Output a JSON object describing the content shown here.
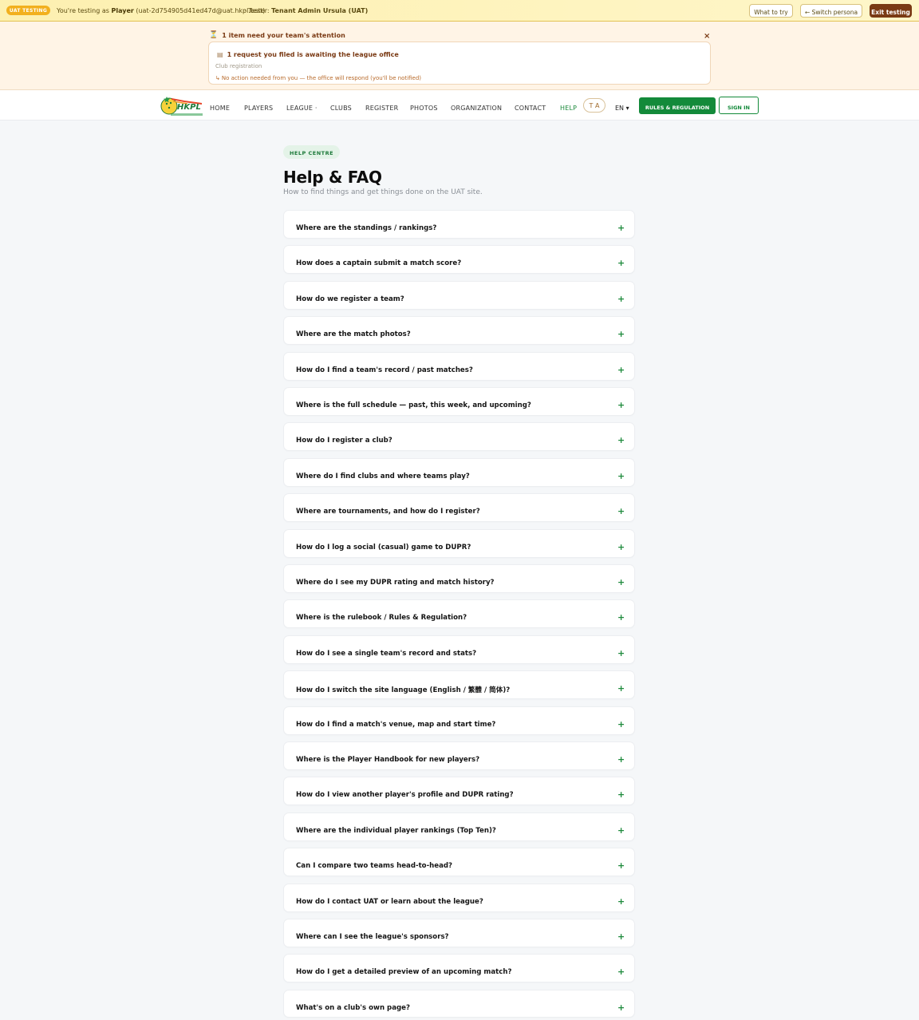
{
  "uat_bar": {
    "badge": "UAT TESTING",
    "testing_prefix": "You're testing as",
    "persona": "Player",
    "persona_email": "(uat-2d754905d41ed47d@uat.hkpl.test)",
    "tester_prefix": "· Tester:",
    "tester_name": "Tenant Admin Ursula (UAT)",
    "what_to_try": "What to try",
    "switch_persona": "← Switch persona",
    "exit_testing": "Exit testing"
  },
  "attention": {
    "icon": "hourglass-icon",
    "title": "1 item need your team's attention",
    "close": "×",
    "card": {
      "icon": "document-icon",
      "headline": "1 request you filed is awaiting the league office",
      "category": "Club registration",
      "note_prefix": "↳",
      "note": "No action needed from you — the office will respond (you'll be notified)"
    }
  },
  "nav": {
    "logo": "HKPL",
    "links": [
      {
        "label": "HOME"
      },
      {
        "label": "PLAYERS"
      },
      {
        "label": "LEAGUE ·"
      },
      {
        "label": "CLUBS"
      },
      {
        "label": "REGISTER"
      },
      {
        "label": "PHOTOS"
      },
      {
        "label": "ORGANIZATION"
      },
      {
        "label": "CONTACT"
      },
      {
        "label": "HELP"
      }
    ],
    "translate_icon": "translate-icon",
    "translate_label": "T A",
    "language": "EN ▾",
    "rules_button": "RULES & REGULATION",
    "signin_button": "SIGN IN",
    "accent": "#138a3a"
  },
  "page": {
    "pill": "HELP CENTRE",
    "title": "Help & FAQ",
    "subtitle": "How to find things and get things done on the UAT site."
  },
  "faq": [
    "Where are the standings / rankings?",
    "How does a captain submit a match score?",
    "How do we register a team?",
    "Where are the match photos?",
    "How do I find a team's record / past matches?",
    "Where is the full schedule — past, this week, and upcoming?",
    "How do I register a club?",
    "Where do I find clubs and where teams play?",
    "Where are tournaments, and how do I register?",
    "How do I log a social (casual) game to DUPR?",
    "Where do I see my DUPR rating and match history?",
    "Where is the rulebook / Rules & Regulation?",
    "How do I see a single team's record and stats?",
    "How do I switch the site language (English / 繁體 / 简体)?",
    "How do I find a match's venue, map and start time?",
    "Where is the Player Handbook for new players?",
    "How do I view another player's profile and DUPR rating?",
    "Where are the individual player rankings (Top Ten)?",
    "Can I compare two teams head-to-head?",
    "How do I contact UAT or learn about the league?",
    "Where can I see the league's sponsors?",
    "How do I get a detailed preview of an upcoming match?",
    "What's on a club's own page?"
  ],
  "faq_expand_symbol": "+"
}
